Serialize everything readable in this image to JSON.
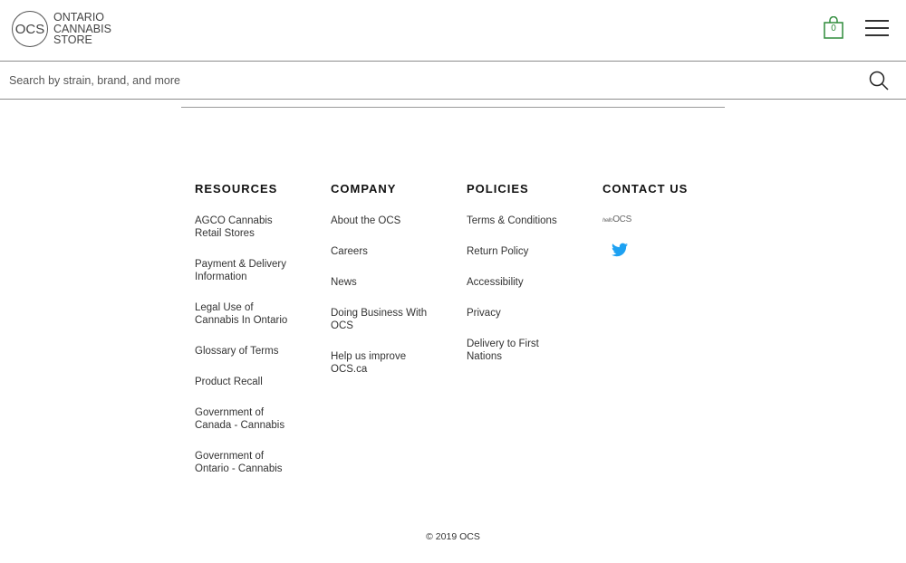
{
  "header": {
    "logo_mark": "OCS",
    "logo_lines": [
      "ONTARIO",
      "CANNABIS",
      "STORE"
    ],
    "cart_count": "0",
    "cart_color": "#2e8b3a"
  },
  "search": {
    "placeholder": "Search by strain, brand, and more",
    "value": ""
  },
  "footer": {
    "columns": [
      {
        "heading": "RESOURCES",
        "links": [
          "AGCO Cannabis Retail Stores",
          "Payment & Delivery Information",
          "Legal Use of Cannabis In Ontario",
          "Glossary of Terms",
          "Product Recall",
          "Government of Canada - Cannabis",
          "Government of Ontario - Cannabis"
        ]
      },
      {
        "heading": "COMPANY",
        "links": [
          "About the OCS",
          "Careers",
          "News",
          "Doing Business With OCS",
          "Help us improve OCS.ca"
        ]
      },
      {
        "heading": "POLICIES",
        "links": [
          "Terms & Conditions",
          "Return Policy",
          "Accessibility",
          "Privacy",
          "Delivery to First Nations"
        ]
      },
      {
        "heading": "CONTACT US",
        "hello_logo": [
          "hello",
          "OCS"
        ],
        "social": [
          "twitter-icon"
        ],
        "twitter_color": "#1da1f2"
      }
    ],
    "copyright": "© 2019 OCS"
  }
}
